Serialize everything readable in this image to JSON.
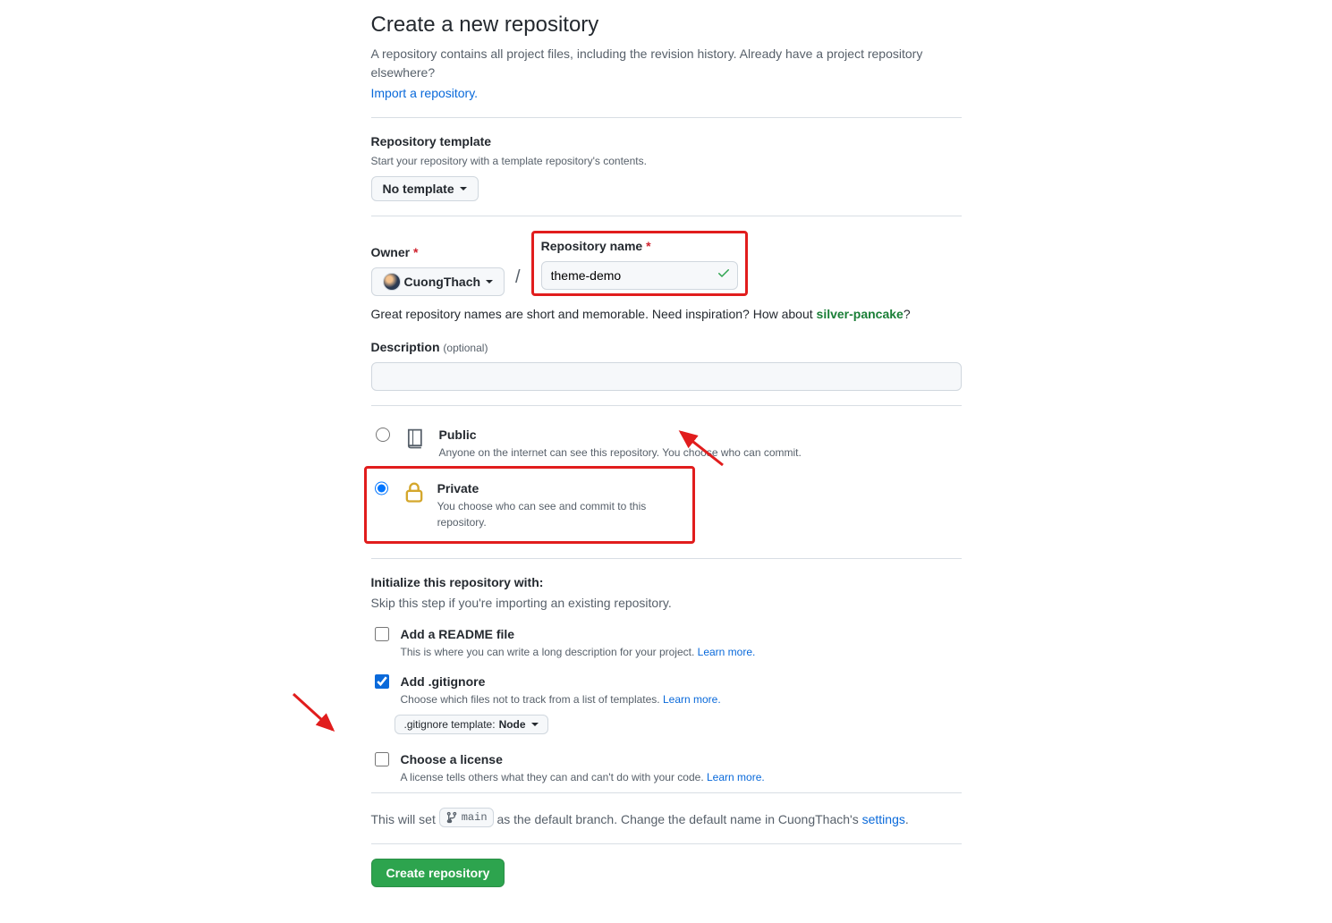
{
  "header": {
    "title": "Create a new repository",
    "subtitle": "A repository contains all project files, including the revision history. Already have a project repository elsewhere?",
    "import_link": "Import a repository."
  },
  "template": {
    "heading": "Repository template",
    "sub": "Start your repository with a template repository's contents.",
    "button": "No template"
  },
  "owner": {
    "label": "Owner",
    "username": "CuongThach"
  },
  "repo_name": {
    "label": "Repository name",
    "value": "theme-demo"
  },
  "hint": {
    "pre": "Great repository names are short and memorable. Need inspiration? How about ",
    "suggestion": "silver-pancake",
    "post": "?"
  },
  "description": {
    "label": "Description",
    "optional": "(optional)",
    "value": ""
  },
  "visibility": {
    "public": {
      "title": "Public",
      "desc": "Anyone on the internet can see this repository. You choose who can commit."
    },
    "private": {
      "title": "Private",
      "desc": "You choose who can see and commit to this repository."
    }
  },
  "init": {
    "heading": "Initialize this repository with:",
    "sub": "Skip this step if you're importing an existing repository.",
    "readme": {
      "title": "Add a README file",
      "desc": "This is where you can write a long description for your project. ",
      "learn": "Learn more."
    },
    "gitignore": {
      "title": "Add .gitignore",
      "desc": "Choose which files not to track from a list of templates. ",
      "learn": "Learn more.",
      "template_prefix": ".gitignore template: ",
      "template_value": "Node"
    },
    "license": {
      "title": "Choose a license",
      "desc": "A license tells others what they can and can't do with your code. ",
      "learn": "Learn more."
    }
  },
  "branch": {
    "pre": "This will set ",
    "name": "main",
    "mid": " as the default branch. Change the default name in CuongThach's ",
    "link": "settings",
    "post": "."
  },
  "submit": {
    "label": "Create repository"
  }
}
